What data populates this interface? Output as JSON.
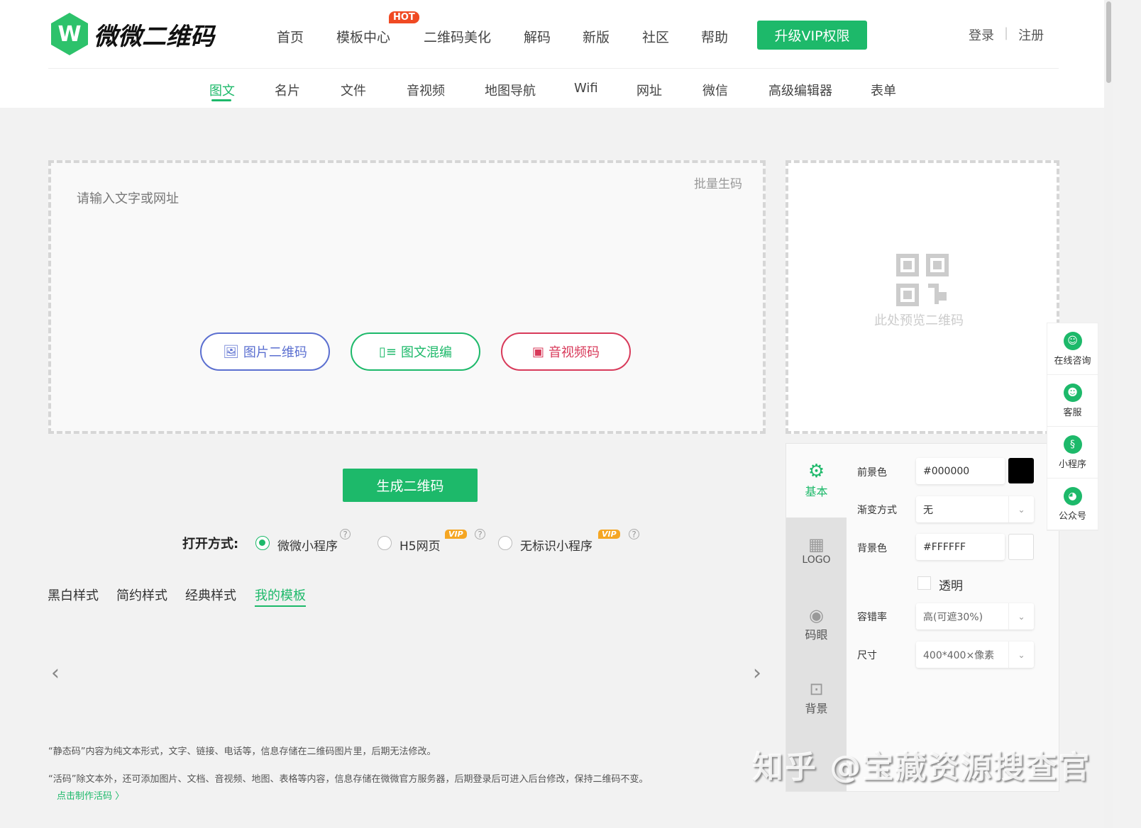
{
  "header": {
    "logo": "微微二维码",
    "logo_mark": "W",
    "nav": [
      "首页",
      "模板中心",
      "二维码美化",
      "解码",
      "新版",
      "社区",
      "帮助"
    ],
    "hot_badge": "HOT",
    "vip_button": "升级VIP权限",
    "login": "登录",
    "separator": "|",
    "register": "注册"
  },
  "subnav": {
    "items": [
      "图文",
      "名片",
      "文件",
      "音视频",
      "地图导航",
      "Wifi",
      "网址",
      "微信",
      "高级编辑器",
      "表单"
    ],
    "active": "图文"
  },
  "editor": {
    "placeholder": "请输入文字或网址",
    "batch": "批量生码",
    "buttons": [
      "图片二维码",
      "图文混编",
      "音视频码"
    ]
  },
  "preview": {
    "text": "此处预览二维码"
  },
  "generate_button": "生成二维码",
  "open_mode": {
    "label": "打开方式:",
    "options": [
      "微微小程序",
      "H5网页",
      "无标识小程序"
    ],
    "selected": "微微小程序",
    "vip_badge": "VIP",
    "help": "?"
  },
  "template_tabs": {
    "items": [
      "黑白样式",
      "简约样式",
      "经典样式",
      "我的模板"
    ],
    "active": "我的模板"
  },
  "carousel": {
    "prev": "‹",
    "next": "›"
  },
  "notes": {
    "static": "“静态码”内容为纯文本形式，文字、链接、电话等，信息存储在二维码图片里，后期无法修改。",
    "dynamic": "“活码”除文本外，还可添加图片、文档、音视频、地图、表格等内容，信息存储在微微官方服务器，后期登录后可进入后台修改，保持二维码不变。",
    "link": "点击制作活码 〉"
  },
  "settings": {
    "tabs": [
      "基本",
      "LOGO",
      "码眼",
      "背景"
    ],
    "active": "基本",
    "foreground_label": "前景色",
    "foreground": "#000000",
    "gradient_label": "渐变方式",
    "gradient": "无",
    "background_label": "背景色",
    "background": "#FFFFFF",
    "transparent_label": "透明",
    "ecc_label": "容错率",
    "ecc": "高(可遮30%)",
    "size_label": "尺寸",
    "size": "400*400×像素"
  },
  "float_bar": [
    "在线咨询",
    "客服",
    "小程序",
    "公众号"
  ],
  "watermark": "知乎 @宝藏资源搜查官",
  "colors": {
    "accent": "#1db96a",
    "hot": "#f04a23",
    "vip": "#f5a623",
    "image_btn": "#5b6fd0",
    "mixed_btn": "#1db96a",
    "av_btn": "#d83a5a"
  }
}
